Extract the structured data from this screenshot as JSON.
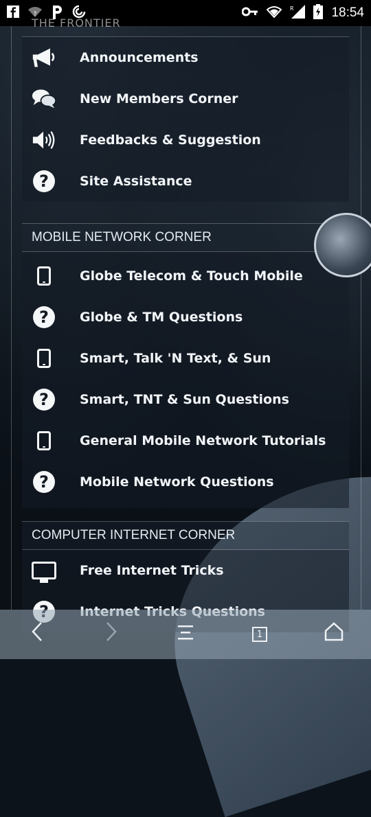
{
  "status_bar": {
    "time": "18:54",
    "icons_left": [
      "facebook-icon",
      "wifi-question-icon",
      "p-app-icon",
      "swirl-app-icon"
    ],
    "icons_right": [
      "key-icon",
      "wifi-icon",
      "signal-icon",
      "battery-icon"
    ]
  },
  "cut_heading": "THE FRONTIER",
  "sections": [
    {
      "header": "",
      "items": [
        {
          "label": "Announcements",
          "icon": "megaphone-icon"
        },
        {
          "label": "New Members Corner",
          "icon": "chat-bubbles-icon"
        },
        {
          "label": "Feedbacks & Suggestion",
          "icon": "speaker-icon"
        },
        {
          "label": "Site Assistance",
          "icon": "question-icon"
        }
      ]
    },
    {
      "header": "MOBILE NETWORK CORNER",
      "items": [
        {
          "label": "Globe Telecom & Touch Mobile",
          "icon": "tablet-icon"
        },
        {
          "label": "Globe & TM Questions",
          "icon": "question-icon"
        },
        {
          "label": "Smart, Talk 'N Text, & Sun",
          "icon": "tablet-icon"
        },
        {
          "label": "Smart, TNT & Sun Questions",
          "icon": "question-icon"
        },
        {
          "label": "General Mobile Network Tutorials",
          "icon": "tablet-icon"
        },
        {
          "label": "Mobile Network Questions",
          "icon": "question-icon"
        }
      ]
    },
    {
      "header": "COMPUTER INTERNET CORNER",
      "items": [
        {
          "label": "Free Internet Tricks",
          "icon": "monitor-icon"
        },
        {
          "label": "Internet Tricks Questions",
          "icon": "question-icon"
        }
      ]
    }
  ],
  "bottom_bar": {
    "tab_count": "1",
    "icons": [
      "back-icon",
      "forward-icon",
      "menu-icon",
      "tabs-icon",
      "home-icon"
    ]
  }
}
